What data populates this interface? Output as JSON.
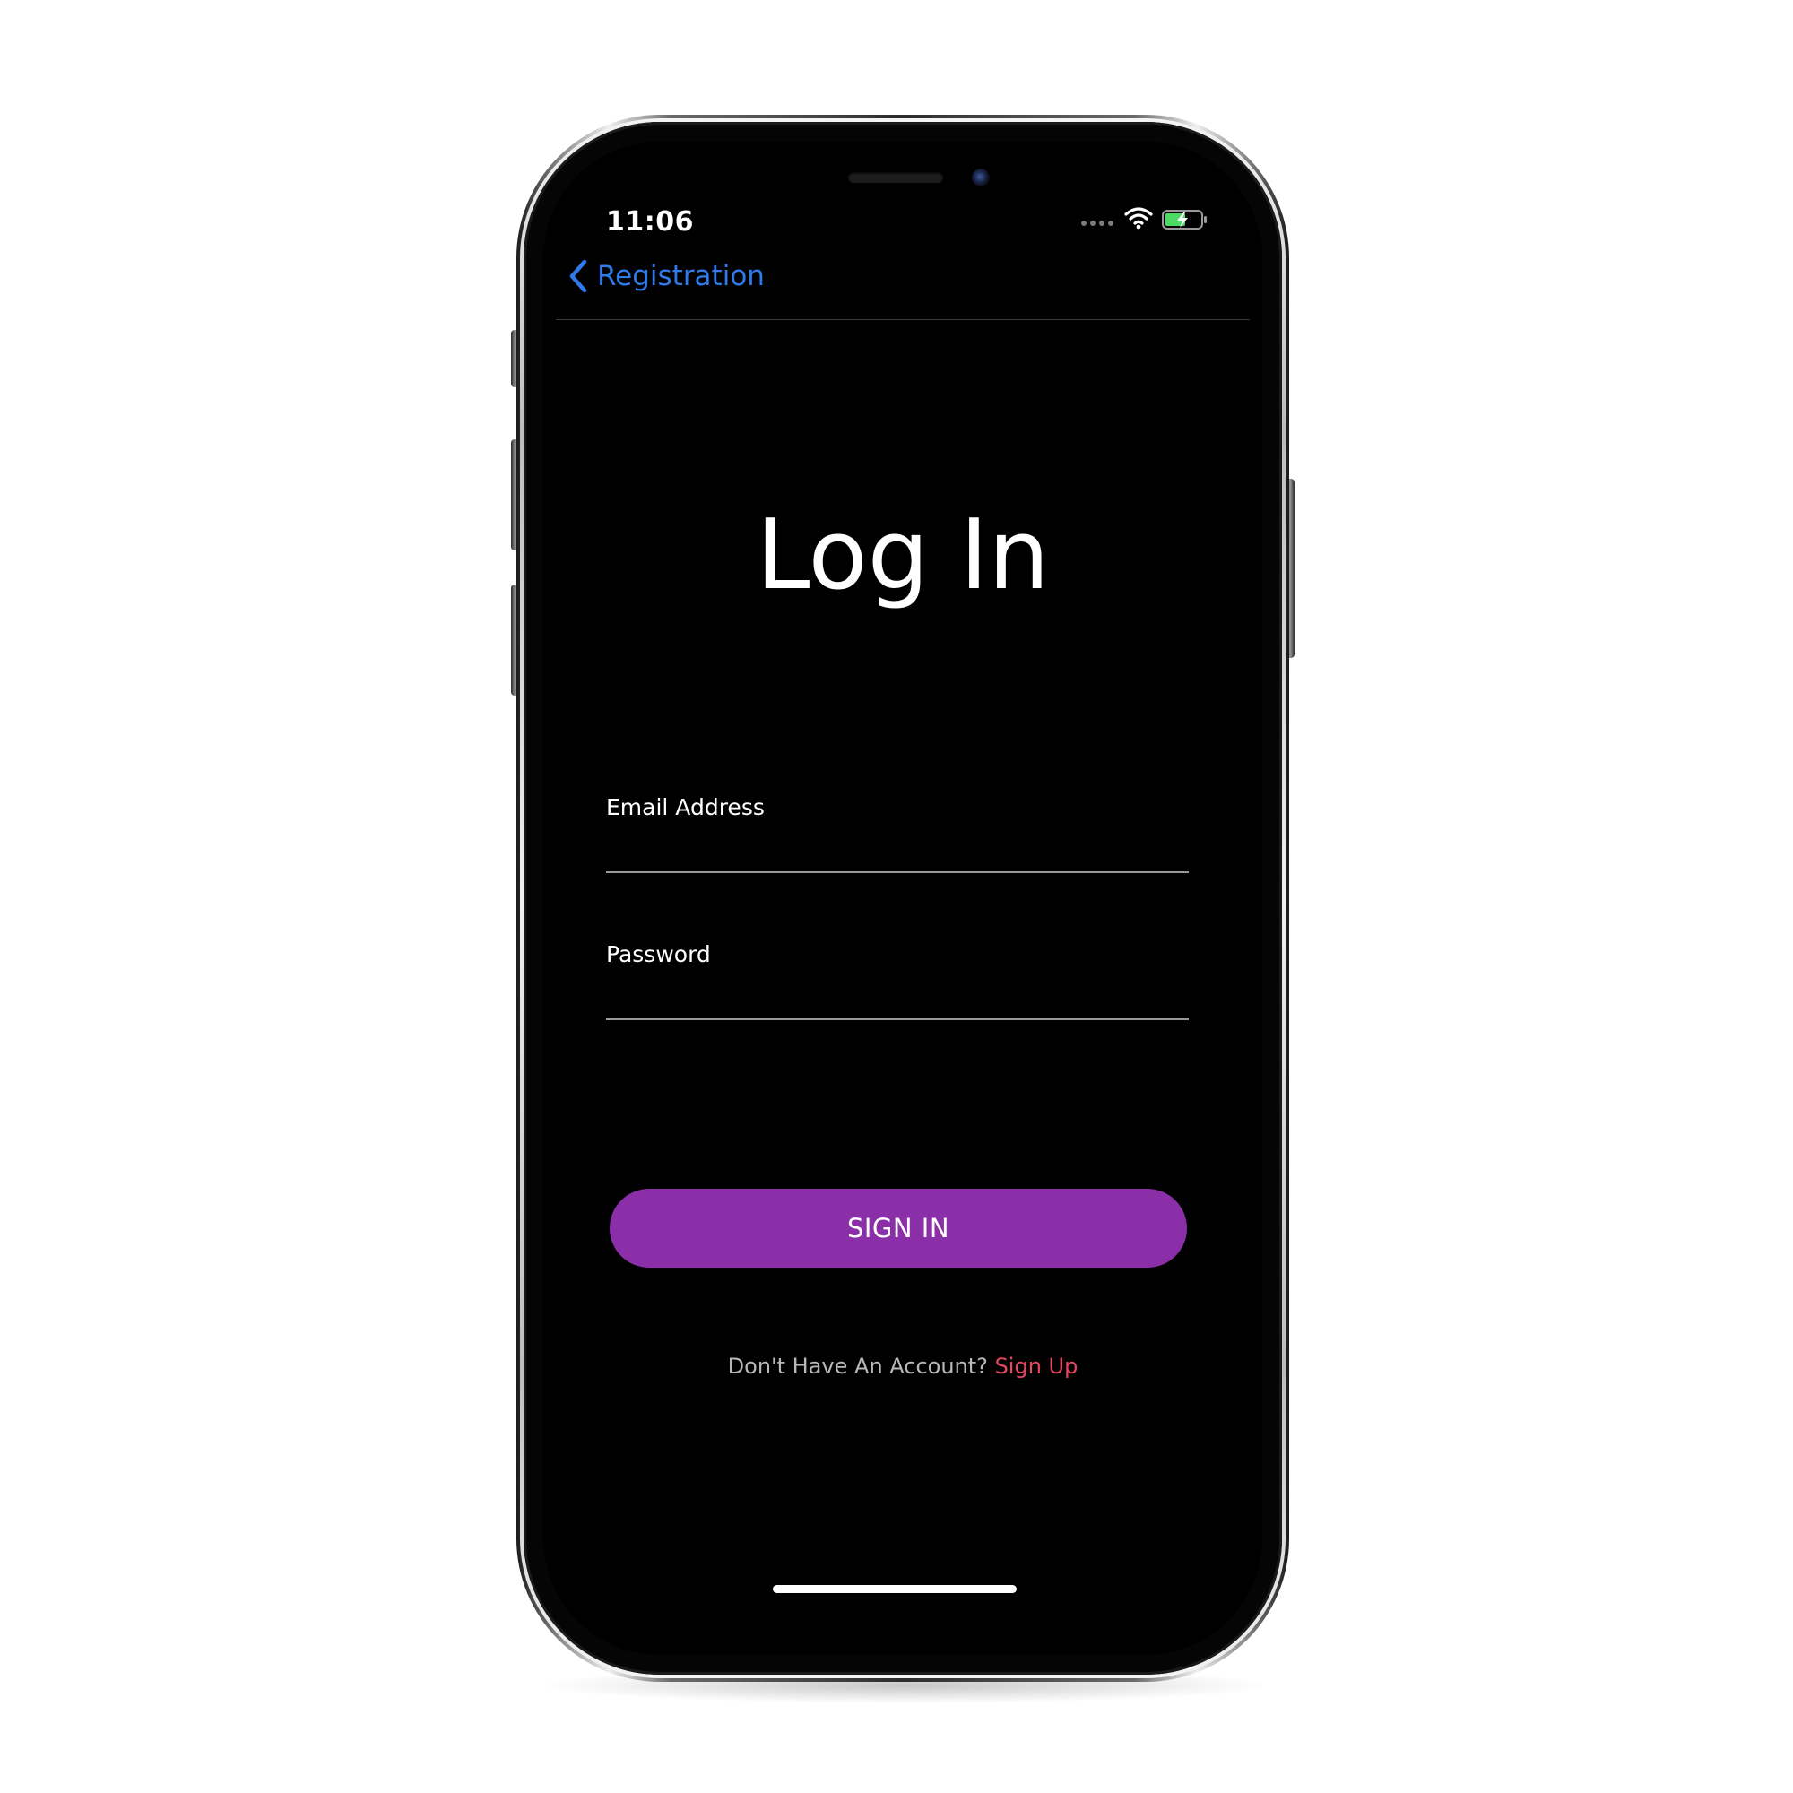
{
  "status_bar": {
    "time": "11:06",
    "icons": [
      "signal-dots-icon",
      "wifi-icon",
      "battery-charging-icon"
    ]
  },
  "nav": {
    "back_label": "Registration",
    "back_icon": "chevron-left-icon"
  },
  "page": {
    "title": "Log In"
  },
  "form": {
    "email_label": "Email Address",
    "email_value": "",
    "password_label": "Password",
    "password_value": ""
  },
  "actions": {
    "sign_in_label": "SIGN IN",
    "signup_prompt": "Don't Have An Account?",
    "signup_link": "Sign Up"
  },
  "colors": {
    "background": "#000000",
    "accent_link": "#2f79e8",
    "button": "#8b2fa8",
    "signup_link": "#e8455f",
    "battery_fill": "#4cd964"
  }
}
